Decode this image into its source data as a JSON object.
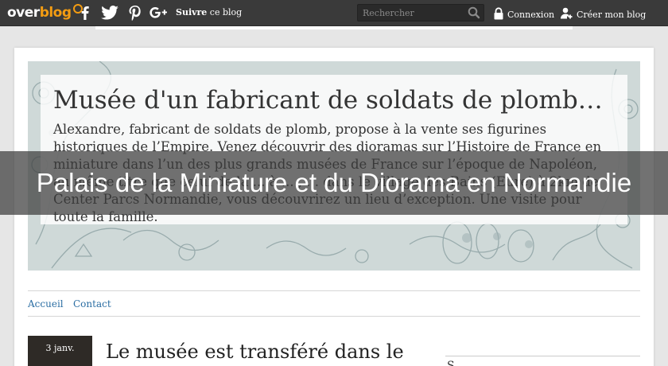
{
  "topbar": {
    "logo_part1": "over",
    "logo_part2": "blog",
    "follow_bold": "Suivre",
    "follow_rest": " ce blog",
    "search_placeholder": "Rechercher",
    "login_label": "Connexion",
    "create_label": "Créer mon blog"
  },
  "blog": {
    "title": "Musée d'un fabricant de soldats de plomb…",
    "description": "Alexandre, fabricant de soldats de plomb, propose à la vente ses figurines historiques de l’Empire. Venez découvrir des dioramas sur l’Histoire de France en miniature dans l’un des plus grands musées de France sur l’époque de Napoléon, au même titre que celui de la ... à ... , ... dans le village des Bains (Eure) à 2km de Center Parcs Normandie, vous découvrirez un lieu d’exception. Une visite pour toute la famille."
  },
  "overlay": {
    "text": "Palais de la Miniature et du Diorama en Normandie"
  },
  "menu": {
    "items": [
      "Accueil",
      "Contact"
    ]
  },
  "article": {
    "date": "3 janv.",
    "title": "Le musée est transféré dans le"
  },
  "sidebar": {
    "title": "S..."
  },
  "colors": {
    "topbar": "#3a3a3a",
    "accent": "#f39c12",
    "link": "#2b6ea3",
    "banner": "#cfd9d8"
  }
}
